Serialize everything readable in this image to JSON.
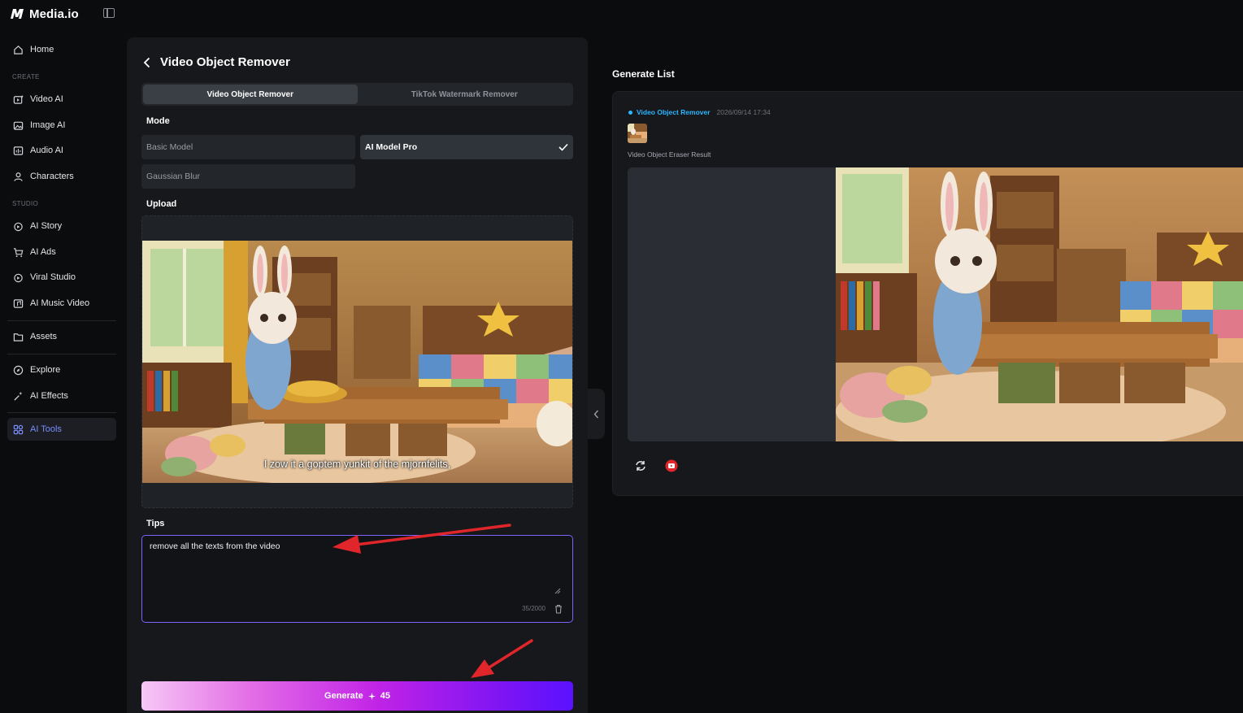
{
  "brand": {
    "name": "Media.io"
  },
  "sidebar": {
    "items_top": [
      {
        "label": "Home",
        "icon": "home-icon"
      }
    ],
    "section_create": "CREATE",
    "create_items": [
      {
        "label": "Video AI"
      },
      {
        "label": "Image AI"
      },
      {
        "label": "Audio AI"
      },
      {
        "label": "Characters"
      }
    ],
    "section_studio": "STUDIO",
    "studio_items": [
      {
        "label": "AI Story"
      },
      {
        "label": "AI Ads"
      },
      {
        "label": "Viral Studio"
      },
      {
        "label": "AI Music Video"
      }
    ],
    "assets": "Assets",
    "explore": "Explore",
    "effects": "AI Effects",
    "tools": "AI Tools",
    "active_color": "#7b8cff"
  },
  "panel": {
    "title": "Video Object Remover",
    "tabs": [
      "Video Object Remover",
      "TikTok Watermark Remover"
    ],
    "mode_label": "Mode",
    "modes": [
      "Basic Model",
      "AI Model Pro",
      "Gaussian Blur"
    ],
    "selected_mode": "AI Model Pro",
    "upload_label": "Upload",
    "video_caption": "I zow it a goptem yunkit of the mjornfelits,",
    "tips_label": "Tips",
    "tips_value": "remove all the texts from the video",
    "tips_count": "35/2000",
    "generate_label": "Generate",
    "generate_cost": "45"
  },
  "generate_list": {
    "title": "Generate List",
    "items": [
      {
        "tool": "Video Object Remover",
        "timestamp": "2026/09/14 17:34",
        "result_label": "Video Object Eraser Result"
      }
    ]
  },
  "colors": {
    "accent": "#7b63ff",
    "link": "#2bb6ff",
    "annotation": "#e0262b"
  }
}
